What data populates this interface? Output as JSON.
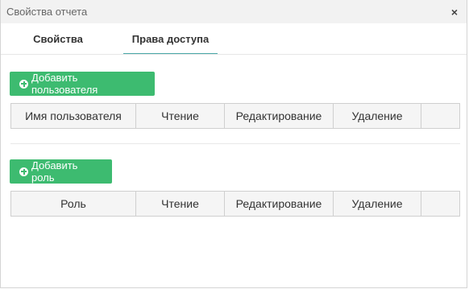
{
  "dialog": {
    "title": "Свойства отчета",
    "close_symbol": "×"
  },
  "tabs": [
    {
      "label": "Свойства",
      "active": false
    },
    {
      "label": "Права доступа",
      "active": true
    }
  ],
  "users_section": {
    "add_button_label": "Добавить пользователя",
    "columns": [
      "Имя пользователя",
      "Чтение",
      "Редактирование",
      "Удаление",
      ""
    ]
  },
  "roles_section": {
    "add_button_label": "Добавить роль",
    "columns": [
      "Роль",
      "Чтение",
      "Редактирование",
      "Удаление",
      ""
    ]
  },
  "icons": {
    "add_icon": "plus-circle-icon",
    "close_icon": "close-icon"
  },
  "colors": {
    "accent_green": "#3dbb70",
    "active_tab_underline": "#4aa8a8",
    "titlebar_bg": "#f2f2f2"
  }
}
